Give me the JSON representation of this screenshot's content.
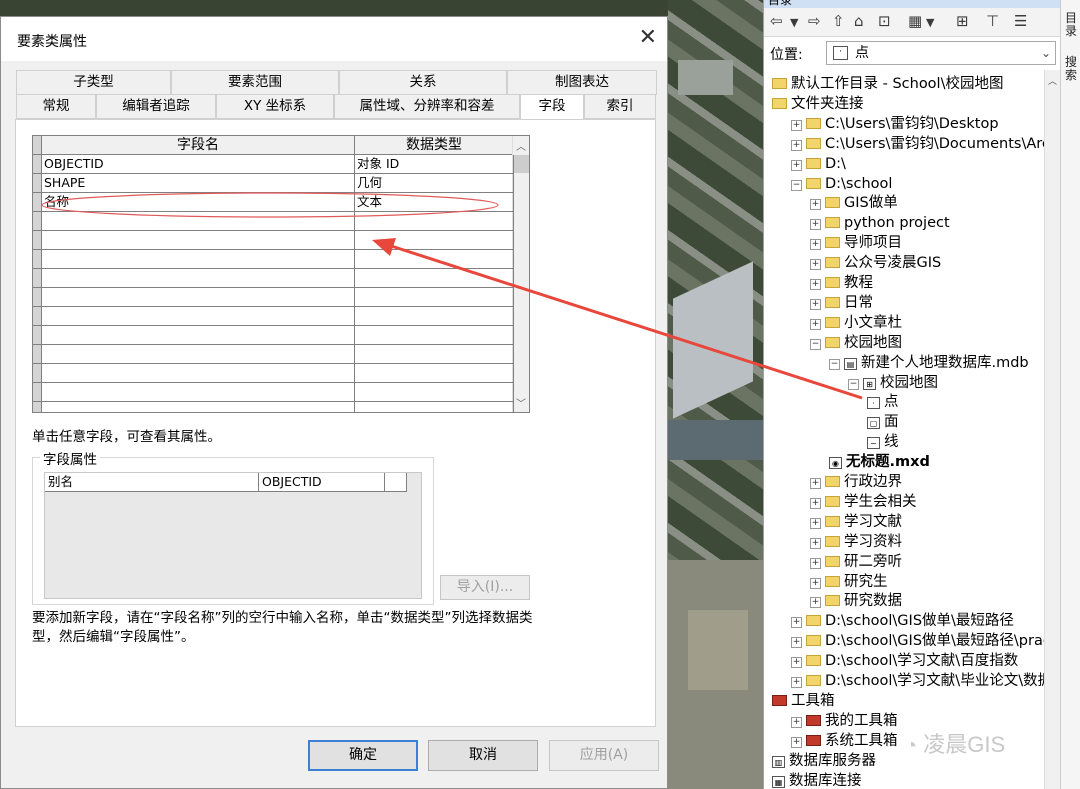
{
  "dialog": {
    "title": "要素类属性",
    "close_glyph": "✕",
    "tabs_row1": [
      "子类型",
      "要素范围",
      "关系",
      "制图表达"
    ],
    "tabs_row2": [
      "常规",
      "编辑者追踪",
      "XY 坐标系",
      "属性域、分辨率和容差",
      "字段",
      "索引"
    ],
    "active_tab": "字段",
    "grid": {
      "columns": [
        "字段名",
        "数据类型"
      ],
      "rows": [
        {
          "name": "OBJECTID",
          "type": "对象 ID"
        },
        {
          "name": "SHAPE",
          "type": "几何"
        },
        {
          "name": "名称",
          "type": "文本"
        }
      ],
      "empty_rows": 11
    },
    "hint": "单击任意字段，可查看其属性。",
    "field_props": {
      "legend": "字段属性",
      "rows": [
        {
          "label": "别名",
          "value": "OBJECTID"
        }
      ],
      "import_button": "导入(I)..."
    },
    "add_note": "要添加新字段，请在“字段名称”列的空行中输入名称，单击“数据类型”列选择数据类型，然后编辑“字段属性”。",
    "buttons": {
      "ok": "确定",
      "cancel": "取消",
      "apply": "应用(A)"
    }
  },
  "catalog": {
    "title": "目录",
    "location_label": "位置:",
    "location_value": "点",
    "tree": [
      {
        "label": "默认工作目录 - School\\校园地图",
        "indent": 0,
        "icon": "folder-icon",
        "pm": ""
      },
      {
        "label": "文件夹连接",
        "indent": 0,
        "icon": "folder-icon",
        "pm": ""
      },
      {
        "label": "C:\\Users\\雷钧钧\\Desktop",
        "indent": 1,
        "icon": "folder-icon",
        "pm": "+"
      },
      {
        "label": "C:\\Users\\雷钧钧\\Documents\\Arc",
        "indent": 1,
        "icon": "folder-icon",
        "pm": "+"
      },
      {
        "label": "D:\\",
        "indent": 1,
        "icon": "folder-icon",
        "pm": "+"
      },
      {
        "label": "D:\\school",
        "indent": 1,
        "icon": "folder-icon",
        "pm": "-"
      },
      {
        "label": "GIS做单",
        "indent": 2,
        "icon": "folder-icon",
        "pm": "+"
      },
      {
        "label": "python project",
        "indent": 2,
        "icon": "folder-icon",
        "pm": "+"
      },
      {
        "label": "导师项目",
        "indent": 2,
        "icon": "folder-icon",
        "pm": "+"
      },
      {
        "label": "公众号凌晨GIS",
        "indent": 2,
        "icon": "folder-icon",
        "pm": "+"
      },
      {
        "label": "教程",
        "indent": 2,
        "icon": "folder-icon",
        "pm": "+"
      },
      {
        "label": "日常",
        "indent": 2,
        "icon": "folder-icon",
        "pm": "+"
      },
      {
        "label": "小文章杜",
        "indent": 2,
        "icon": "folder-icon",
        "pm": "+"
      },
      {
        "label": "校园地图",
        "indent": 2,
        "icon": "folder-icon",
        "pm": "-"
      },
      {
        "label": "新建个人地理数据库.mdb",
        "indent": 3,
        "icon": "database-icon",
        "pm": "-"
      },
      {
        "label": "校园地图",
        "indent": 4,
        "icon": "dataset-icon",
        "pm": "-"
      },
      {
        "label": "点",
        "indent": 5,
        "icon": "point-icon",
        "pm": ""
      },
      {
        "label": "面",
        "indent": 5,
        "icon": "polygon-icon",
        "pm": ""
      },
      {
        "label": "线",
        "indent": 5,
        "icon": "line-icon",
        "pm": ""
      },
      {
        "label": "无标题.mxd",
        "indent": 3,
        "icon": "mxd-icon",
        "pm": "",
        "bold": true
      },
      {
        "label": "行政边界",
        "indent": 2,
        "icon": "folder-icon",
        "pm": "+"
      },
      {
        "label": "学生会相关",
        "indent": 2,
        "icon": "folder-icon",
        "pm": "+"
      },
      {
        "label": "学习文献",
        "indent": 2,
        "icon": "folder-icon",
        "pm": "+"
      },
      {
        "label": "学习资料",
        "indent": 2,
        "icon": "folder-icon",
        "pm": "+"
      },
      {
        "label": "研二旁听",
        "indent": 2,
        "icon": "folder-icon",
        "pm": "+"
      },
      {
        "label": "研究生",
        "indent": 2,
        "icon": "folder-icon",
        "pm": "+"
      },
      {
        "label": "研究数据",
        "indent": 2,
        "icon": "folder-icon",
        "pm": "+"
      },
      {
        "label": "D:\\school\\GIS做单\\最短路径",
        "indent": 1,
        "icon": "folder-icon",
        "pm": "+"
      },
      {
        "label": "D:\\school\\GIS做单\\最短路径\\prac",
        "indent": 1,
        "icon": "folder-icon",
        "pm": "+"
      },
      {
        "label": "D:\\school\\学习文献\\百度指数",
        "indent": 1,
        "icon": "folder-icon",
        "pm": "+"
      },
      {
        "label": "D:\\school\\学习文献\\毕业论文\\数据",
        "indent": 1,
        "icon": "folder-icon",
        "pm": "+"
      },
      {
        "label": "工具箱",
        "indent": 0,
        "icon": "toolbox-icon",
        "pm": ""
      },
      {
        "label": "我的工具箱",
        "indent": 1,
        "icon": "toolbox-icon",
        "pm": "+"
      },
      {
        "label": "系统工具箱",
        "indent": 1,
        "icon": "toolbox-icon",
        "pm": "+"
      },
      {
        "label": "数据库服务器",
        "indent": 0,
        "icon": "server-icon",
        "pm": ""
      },
      {
        "label": "数据库连接",
        "indent": 0,
        "icon": "connection-icon",
        "pm": ""
      }
    ]
  },
  "side_tabs": [
    "目录",
    "搜索"
  ],
  "watermark": "凌晨GIS",
  "colors": {
    "arrow": "#e8473c",
    "ellipse": "#e05a5a",
    "default_button": "#3c7fd6"
  }
}
